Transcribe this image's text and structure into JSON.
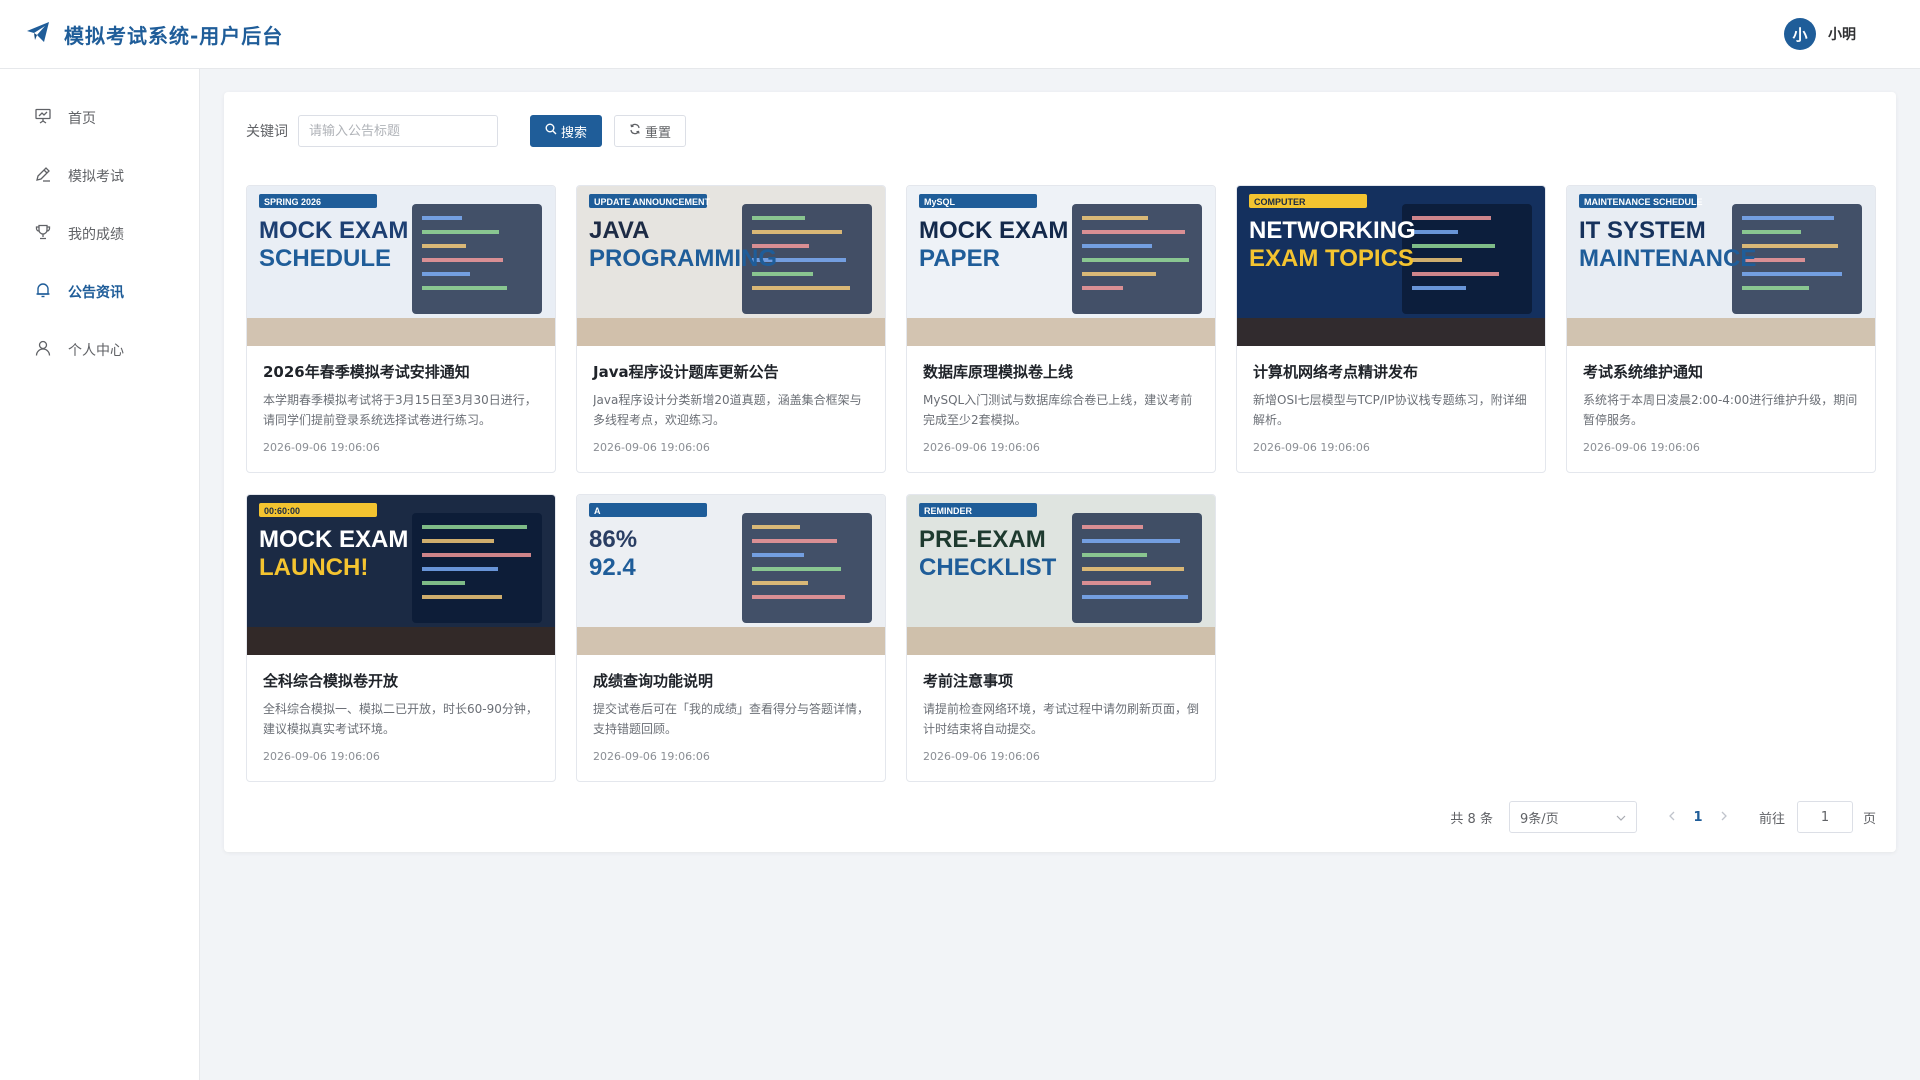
{
  "app": {
    "title": "模拟考试系统-用户后台",
    "brand_color": "#1f5d99"
  },
  "user": {
    "avatar_text": "小",
    "name": "小明"
  },
  "sidebar": {
    "items": [
      {
        "label": "首页",
        "icon": "presentation-icon",
        "active": false
      },
      {
        "label": "模拟考试",
        "icon": "pen-icon",
        "active": false
      },
      {
        "label": "我的成绩",
        "icon": "trophy-icon",
        "active": false
      },
      {
        "label": "公告资讯",
        "icon": "bell-icon",
        "active": true
      },
      {
        "label": "个人中心",
        "icon": "user-icon",
        "active": false
      }
    ]
  },
  "search": {
    "label": "关键词",
    "placeholder": "请输入公告标题",
    "value": "",
    "search_label": "搜索",
    "reset_label": "重置"
  },
  "announcements": [
    {
      "title": "2026年春季模拟考试安排通知",
      "desc": "本学期春季模拟考试将于3月15日至3月30日进行，请同学们提前登录系统选择试卷进行练习。",
      "date": "2026-09-06 19:06:06",
      "img": {
        "line1": "MOCK EXAM",
        "line2": "SCHEDULE",
        "tag": "SPRING 2026",
        "bg": "#e9eef5",
        "fg": "#1d3f72"
      }
    },
    {
      "title": "Java程序设计题库更新公告",
      "desc": "Java程序设计分类新增20道真题，涵盖集合框架与多线程考点，欢迎练习。",
      "date": "2026-09-06 19:06:06",
      "img": {
        "line1": "JAVA",
        "line2": "PROGRAMMING",
        "tag": "UPDATE ANNOUNCEMENT",
        "bg": "#e6e4e0",
        "fg": "#1d2b45"
      }
    },
    {
      "title": "数据库原理模拟卷上线",
      "desc": "MySQL入门测试与数据库综合卷已上线，建议考前完成至少2套模拟。",
      "date": "2026-09-06 19:06:06",
      "img": {
        "line1": "MOCK EXAM",
        "line2": "PAPER",
        "tag": "MySQL",
        "bg": "#eef2f7",
        "fg": "#13294b"
      }
    },
    {
      "title": "计算机网络考点精讲发布",
      "desc": "新增OSI七层模型与TCP/IP协议栈专题练习，附详细解析。",
      "date": "2026-09-06 19:06:06",
      "img": {
        "line1": "NETWORKING",
        "line2": "EXAM TOPICS",
        "tag": "COMPUTER",
        "bg": "#14305e",
        "fg": "#ffffff"
      }
    },
    {
      "title": "考试系统维护通知",
      "desc": "系统将于本周日凌晨2:00-4:00进行维护升级，期间暂停服务。",
      "date": "2026-09-06 19:06:06",
      "img": {
        "line1": "IT SYSTEM",
        "line2": "MAINTENANCE",
        "tag": "MAINTENANCE SCHEDULE",
        "bg": "#e8edf3",
        "fg": "#16325c"
      }
    },
    {
      "title": "全科综合模拟卷开放",
      "desc": "全科综合模拟一、模拟二已开放，时长60-90分钟，建议模拟真实考试环境。",
      "date": "2026-09-06 19:06:06",
      "img": {
        "line1": "MOCK EXAM",
        "line2": "LAUNCH!",
        "tag": "00:60:00",
        "bg": "#1b2a44",
        "fg": "#ffffff"
      }
    },
    {
      "title": "成绩查询功能说明",
      "desc": "提交试卷后可在「我的成绩」查看得分与答题详情，支持错题回顾。",
      "date": "2026-09-06 19:06:06",
      "img": {
        "line1": "86%",
        "line2": "92.4",
        "tag": "A",
        "bg": "#eceff3",
        "fg": "#2a3e63"
      }
    },
    {
      "title": "考前注意事项",
      "desc": "请提前检查网络环境，考试过程中请勿刷新页面，倒计时结束将自动提交。",
      "date": "2026-09-06 19:06:06",
      "img": {
        "line1": "PRE-EXAM",
        "line2": "CHECKLIST",
        "tag": "REMINDER",
        "bg": "#dfe4e0",
        "fg": "#1e3a2f"
      }
    }
  ],
  "pagination": {
    "total_text": "共 8 条",
    "page_size": "9条/页",
    "current": "1",
    "goto_label": "前往",
    "goto_value": "1",
    "page_suffix": "页"
  }
}
